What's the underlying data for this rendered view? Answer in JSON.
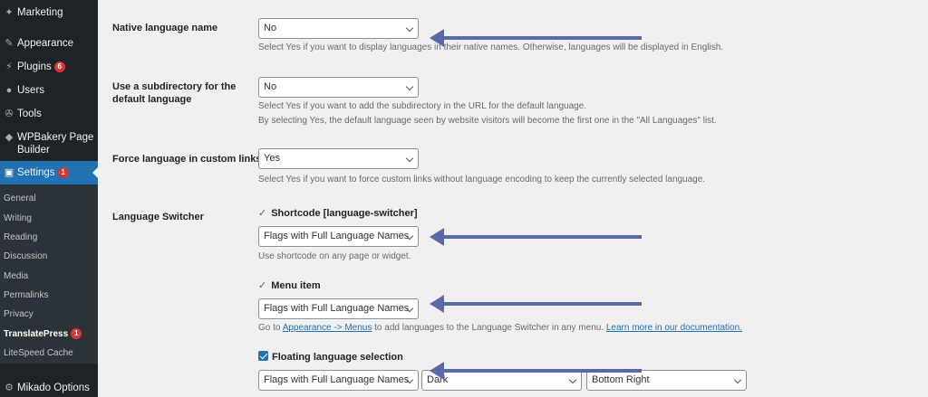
{
  "sidebar": {
    "marketing": "Marketing",
    "appearance": "Appearance",
    "plugins": "Plugins",
    "plugins_badge": "6",
    "users": "Users",
    "tools": "Tools",
    "wpbakery_line1": "WPBakery Page",
    "wpbakery_line2": "Builder",
    "settings": "Settings",
    "settings_badge": "1",
    "submenu": [
      "General",
      "Writing",
      "Reading",
      "Discussion",
      "Media",
      "Permalinks",
      "Privacy",
      "TranslatePress",
      "LiteSpeed Cache"
    ],
    "translatepress_badge": "1",
    "mikado": "Mikado Options"
  },
  "settings": {
    "native": {
      "label": "Native language name",
      "value": "No",
      "desc": "Select Yes if you want to display languages in their native names. Otherwise, languages will be displayed in English."
    },
    "subdir": {
      "label_line1": "Use a subdirectory for the",
      "label_line2": "default language",
      "value": "No",
      "desc1": "Select Yes if you want to add the subdirectory in the URL for the default language.",
      "desc2": "By selecting Yes, the default language seen by website visitors will become the first one in the \"All Languages\" list."
    },
    "force": {
      "label": "Force language in custom links",
      "value": "Yes",
      "desc": "Select Yes if you want to force custom links without language encoding to keep the currently selected language."
    },
    "switcher": {
      "label": "Language Switcher",
      "shortcode_label": "Shortcode [language-switcher]",
      "shortcode_value": "Flags with Full Language Names",
      "shortcode_desc": "Use shortcode on any page or widget.",
      "menu_label": "Menu item",
      "menu_value": "Flags with Full Language Names",
      "menu_desc_pre": "Go to ",
      "menu_desc_link1": "Appearance -> Menus",
      "menu_desc_mid": " to add languages to the Language Switcher in any menu. ",
      "menu_desc_link2": "Learn more in our documentation.",
      "floating_label": "Floating language selection",
      "floating_value": "Flags with Full Language Names",
      "floating_theme": "Dark",
      "floating_position": "Bottom Right"
    }
  },
  "colors": {
    "arrow": "#5a6aa8",
    "accent": "#2271b1",
    "sidebar_bg": "#1d2327"
  }
}
